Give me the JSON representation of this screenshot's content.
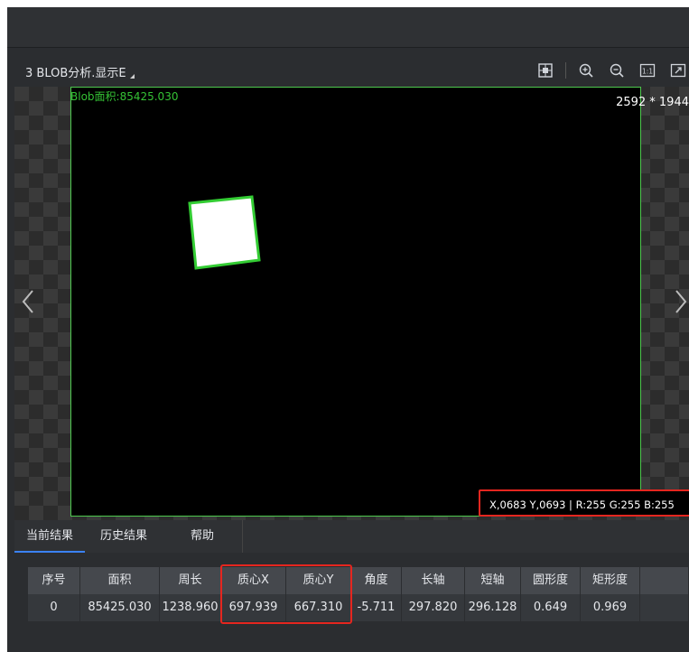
{
  "window": {
    "title": "3 BLOB分析.显示E"
  },
  "toolbar": {
    "icons": [
      "crosshair-grid-icon",
      "zoom-in-icon",
      "zoom-out-icon",
      "actual-size-icon",
      "fit-window-icon"
    ],
    "actual_size_label": "1:1"
  },
  "viewer": {
    "blob_area_label": "Blob面积:85425.030",
    "image_dims": "2592 * 1944",
    "pixel_info": "X,0683  Y,0693  |  R:255  G:255  B:255",
    "accent_color": "#4ec94e",
    "highlight_color": "#e5261f"
  },
  "tabs": [
    {
      "label": "当前结果",
      "active": true
    },
    {
      "label": "历史结果",
      "active": false
    },
    {
      "label": "帮助",
      "active": false
    }
  ],
  "table": {
    "headers": [
      "序号",
      "面积",
      "周长",
      "质心X",
      "质心Y",
      "角度",
      "长轴",
      "短轴",
      "圆形度",
      "矩形度",
      ""
    ],
    "rows": [
      [
        "0",
        "85425.030",
        "1238.960",
        "697.939",
        "667.310",
        "-5.711",
        "297.820",
        "296.128",
        "0.649",
        "0.969",
        ""
      ]
    ]
  }
}
